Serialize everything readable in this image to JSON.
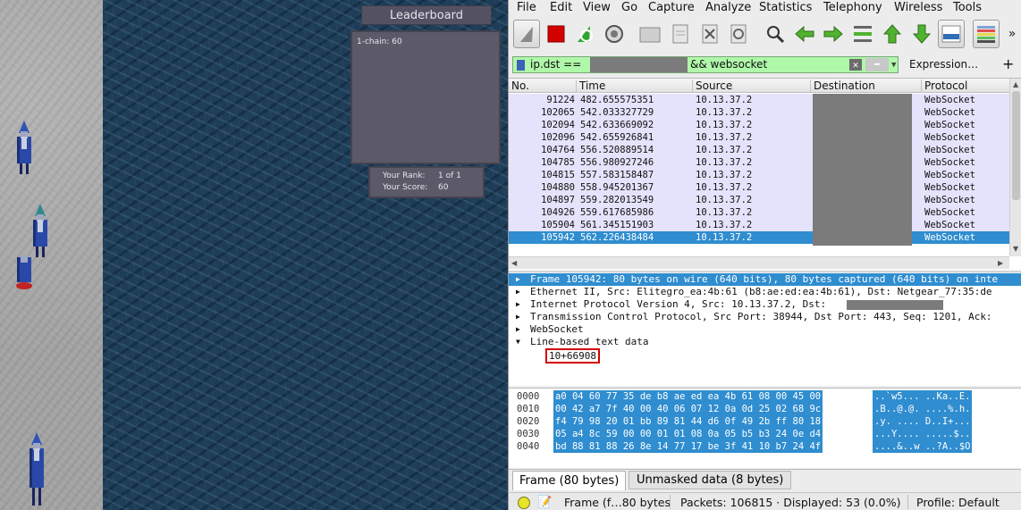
{
  "game": {
    "leaderboard": {
      "title": "Leaderboard",
      "entries": [
        "1-chain: 60"
      ],
      "your_rank_label": "Your Rank:",
      "your_rank_value": "1 of 1",
      "your_score_label": "Your Score:",
      "your_score_value": "60"
    }
  },
  "wireshark": {
    "menu": [
      "File",
      "Edit",
      "View",
      "Go",
      "Capture",
      "Analyze",
      "Statistics",
      "Telephony",
      "Wireless",
      "Tools"
    ],
    "toolbar_icons": [
      "shark-fin-icon",
      "stop-capture-icon",
      "restart-capture-icon",
      "capture-options-icon",
      "open-file-icon",
      "save-file-icon",
      "close-file-icon",
      "reload-icon",
      "find-icon",
      "back-icon",
      "forward-icon",
      "goto-packet-icon",
      "first-packet-icon",
      "last-packet-icon",
      "autoscroll-icon",
      "colorize-icon",
      "more-icon"
    ],
    "filter": {
      "text_prefix": "ip.dst ==",
      "text_suffix": "&& websocket",
      "expression_label": "Expression…",
      "plus_label": "+"
    },
    "packet_list": {
      "columns": [
        "No.",
        "Time",
        "Source",
        "Destination",
        "Protocol"
      ],
      "rows": [
        {
          "no": "91224",
          "time": "482.655575351",
          "source": "10.13.37.2",
          "protocol": "WebSocket"
        },
        {
          "no": "102065",
          "time": "542.033327729",
          "source": "10.13.37.2",
          "protocol": "WebSocket"
        },
        {
          "no": "102094",
          "time": "542.633669092",
          "source": "10.13.37.2",
          "protocol": "WebSocket"
        },
        {
          "no": "102096",
          "time": "542.655926841",
          "source": "10.13.37.2",
          "protocol": "WebSocket"
        },
        {
          "no": "104764",
          "time": "556.520889514",
          "source": "10.13.37.2",
          "protocol": "WebSocket"
        },
        {
          "no": "104785",
          "time": "556.980927246",
          "source": "10.13.37.2",
          "protocol": "WebSocket"
        },
        {
          "no": "104815",
          "time": "557.583158487",
          "source": "10.13.37.2",
          "protocol": "WebSocket"
        },
        {
          "no": "104880",
          "time": "558.945201367",
          "source": "10.13.37.2",
          "protocol": "WebSocket"
        },
        {
          "no": "104897",
          "time": "559.282013549",
          "source": "10.13.37.2",
          "protocol": "WebSocket"
        },
        {
          "no": "104926",
          "time": "559.617685986",
          "source": "10.13.37.2",
          "protocol": "WebSocket"
        },
        {
          "no": "105904",
          "time": "561.345151903",
          "source": "10.13.37.2",
          "protocol": "WebSocket"
        },
        {
          "no": "105942",
          "time": "562.226438484",
          "source": "10.13.37.2",
          "protocol": "WebSocket"
        }
      ],
      "selected_row": 11
    },
    "details": {
      "rows": [
        "Frame 105942: 80 bytes on wire (640 bits), 80 bytes captured (640 bits) on inte",
        "Ethernet II, Src: Elitegro_ea:4b:61 (b8:ae:ed:ea:4b:61), Dst: Netgear_77:35:de",
        "Internet Protocol Version 4, Src: 10.13.37.2, Dst:",
        "Transmission Control Protocol, Src Port: 38944, Dst Port: 443, Seq: 1201, Ack:",
        "WebSocket",
        "Line-based text data"
      ],
      "line_based_value": "10+66908"
    },
    "hex_dump": {
      "rows": [
        {
          "offset": "0000",
          "hex": "a0 04 60 77 35 de b8 ae  ed ea 4b 61 08 00 45 00",
          "ascii": "..`w5... ..Ka..E."
        },
        {
          "offset": "0010",
          "hex": "00 42 a7 7f 40 00 40 06  07 12 0a 0d 25 02 68 9c",
          "ascii": ".B..@.@. ....%.h."
        },
        {
          "offset": "0020",
          "hex": "f4 79 98 20 01 bb 89 81  44 d6 0f 49 2b ff 80 18",
          "ascii": ".y. .... D..I+..."
        },
        {
          "offset": "0030",
          "hex": "05 a4 8c 59 00 00 01 01  08 0a 05 b5 b3 24 0e d4",
          "ascii": "...Y.... .....$.."
        },
        {
          "offset": "0040",
          "hex": "bd 88 81 88 26 8e 14 77  17 be 3f 41 10 b7 24 4f",
          "ascii": "....&..w ..?A..$O"
        }
      ]
    },
    "bottom_tabs": [
      "Frame (80 bytes)",
      "Unmasked data (8 bytes)"
    ],
    "status": {
      "frame": "Frame (f…80 bytes",
      "packets": "Packets: 106815 · Displayed: 53 (0.0%)",
      "profile": "Profile: Default"
    }
  }
}
